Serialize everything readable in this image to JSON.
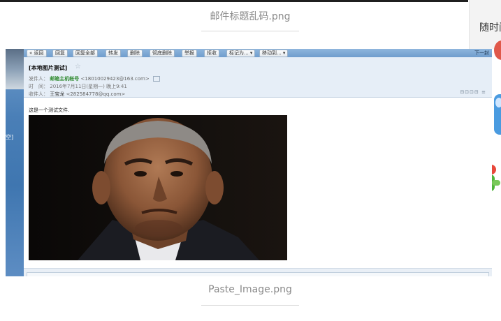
{
  "captions": {
    "top": "邮件标题乱码.png",
    "bottom": "Paste_Image.png"
  },
  "side_panel": {
    "text": "随时阅"
  },
  "email_client": {
    "left_bar_text": "空]",
    "toolbar": {
      "buttons": [
        "« 返回",
        "回复",
        "回复全部",
        "转发",
        "删除",
        "彻底删除",
        "举报",
        "拒收",
        "标记为... ▾",
        "移动到... ▾"
      ],
      "right_label": "下一封"
    },
    "message": {
      "subject": "[本地图片测试]",
      "from_label": "发件人：",
      "from_name": "邮箱主机帐号",
      "from_addr": "<18010029423@163.com>",
      "time_label": "时　间：",
      "time_value": "2016年7月11日(星期一) 晚上9:41",
      "to_label": "收件人：",
      "to_name": "王宝龙",
      "to_addr": "<282584778@qq.com>",
      "header_icons": "⊟⊡⊡⊟ ≡",
      "body_text": "这是一个测试文件."
    }
  },
  "colors": {
    "toolbar": "#7aa6d4",
    "header_bg": "#e6eef7",
    "accent_green": "#2f8a2f",
    "left_bar": "#4a7fb7"
  }
}
